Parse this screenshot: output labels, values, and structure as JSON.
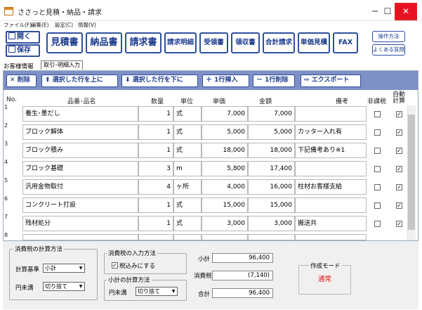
{
  "window": {
    "title": "ささっと見積・納品・請求",
    "minimize": "─",
    "maximize": "☐",
    "close": "✕"
  },
  "menu": [
    "ファイル(F)",
    "編集(E)",
    "設定(C)",
    "情報(V)"
  ],
  "side_buttons": {
    "open": "開く",
    "save": "保存"
  },
  "doc_buttons": [
    "見積書",
    "納品書",
    "請求書"
  ],
  "mid_buttons": [
    "請求明細",
    "受領書",
    "領収書",
    "合計請求",
    "単価見積",
    "FAX"
  ],
  "help_buttons": {
    "manual": "操作方法",
    "faq": "よくある質問"
  },
  "tabs": {
    "customer": "お客様情報",
    "active": "取引･明細入力"
  },
  "actions": {
    "delete": "削除",
    "row_up": "選択した行を上に",
    "row_down": "選択した行を下に",
    "insert": "1行挿入",
    "remove": "1行削除",
    "export": "エクスポート"
  },
  "columns": {
    "no": "No.",
    "item": "品番･品名",
    "qty": "数量",
    "unit": "単位",
    "price": "単価",
    "amount": "金額",
    "note": "備考",
    "nontax": "非課税",
    "auto": "自動\n計算"
  },
  "rows": [
    {
      "no": "1",
      "item": "養生･墨だし",
      "qty": "1",
      "unit": "式",
      "price": "7,000",
      "amount": "7,000",
      "note": "",
      "nontax": false,
      "auto": true
    },
    {
      "no": "2",
      "item": "ブロック解体",
      "qty": "1",
      "unit": "式",
      "price": "5,000",
      "amount": "5,000",
      "note": "カッター入れ有",
      "nontax": false,
      "auto": true
    },
    {
      "no": "3",
      "item": "ブロック積み",
      "qty": "1",
      "unit": "式",
      "price": "18,000",
      "amount": "18,000",
      "note": "下記備考あり※1",
      "nontax": false,
      "auto": true
    },
    {
      "no": "4",
      "item": "ブロック基礎",
      "qty": "3",
      "unit": "m",
      "price": "5,800",
      "amount": "17,400",
      "note": "",
      "nontax": false,
      "auto": true
    },
    {
      "no": "5",
      "item": "汎用金物取付",
      "qty": "4",
      "unit": "ヶ所",
      "price": "4,000",
      "amount": "16,000",
      "note": "柱材お客様支給",
      "nontax": false,
      "auto": true
    },
    {
      "no": "6",
      "item": "コンクリート打設",
      "qty": "1",
      "unit": "式",
      "price": "15,000",
      "amount": "15,000",
      "note": "",
      "nontax": false,
      "auto": true
    },
    {
      "no": "7",
      "item": "残材処分",
      "qty": "1",
      "unit": "式",
      "price": "3,000",
      "amount": "3,000",
      "note": "搬送共",
      "nontax": false,
      "auto": true
    },
    {
      "no": "8",
      "item": "",
      "qty": "",
      "unit": "",
      "price": "",
      "amount": "",
      "note": "",
      "nontax": false,
      "auto": true
    }
  ],
  "tax_calc": {
    "legend": "消費税の計算方法",
    "basis_label": "計算基準",
    "basis_value": "小計",
    "round_label": "円未満",
    "round_value": "切り捨て"
  },
  "tax_input": {
    "legend": "消費税の入力方法",
    "checkbox_label": "税込みにする",
    "checked": true
  },
  "subtotal_calc": {
    "legend": "小計の計算方法",
    "round_label": "円未満",
    "round_value": "切り捨て"
  },
  "totals": {
    "subtotal_label": "小計",
    "subtotal": "96,400",
    "tax_label": "消費税",
    "tax": "(7,140)",
    "total_label": "合計",
    "total": "96,400"
  },
  "mode": {
    "legend": "作成モード",
    "value": "通常",
    "color": "#e01010"
  }
}
